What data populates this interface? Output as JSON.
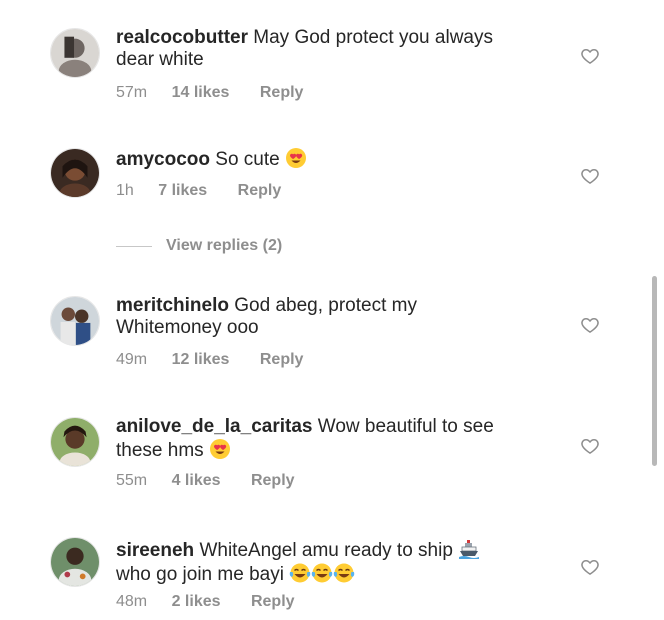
{
  "comments": [
    {
      "username": "realcocobutter",
      "text_line1": "May God protect you always",
      "text_line2": "dear white",
      "time": "57m",
      "likes": "14 likes",
      "reply": "Reply",
      "avatar_icon": "avatar-photo-icon",
      "emoji": []
    },
    {
      "username": "amycocoo",
      "text_line1": "So cute",
      "text_line2": "",
      "time": "1h",
      "likes": "7 likes",
      "reply": "Reply",
      "avatar_icon": "avatar-photo-icon",
      "emoji": [
        "heart-eyes-emoji"
      ]
    },
    {
      "username": "meritchinelo",
      "text_line1": "God abeg, protect my",
      "text_line2": "Whitemoney ooo",
      "time": "49m",
      "likes": "12 likes",
      "reply": "Reply",
      "avatar_icon": "avatar-photo-icon",
      "emoji": []
    },
    {
      "username": "anilove_de_la_caritas",
      "text_line1": "Wow beautiful to see",
      "text_line2": "these hms",
      "time": "55m",
      "likes": "4 likes",
      "reply": "Reply",
      "avatar_icon": "avatar-photo-icon",
      "emoji": [
        "heart-eyes-emoji"
      ]
    },
    {
      "username": "sireeneh",
      "text_line1": "WhiteAngel amu ready to ship",
      "text_line2": "who go join me bayi",
      "time": "48m",
      "likes": "2 likes",
      "reply": "Reply",
      "avatar_icon": "avatar-photo-icon",
      "emoji": [
        "ship-emoji",
        "tears-of-joy-emoji",
        "tears-of-joy-emoji",
        "tears-of-joy-emoji"
      ]
    }
  ],
  "view_replies": {
    "label": "View replies (2)"
  },
  "icons": {
    "like": "heart-outline-icon"
  },
  "colors": {
    "text_primary": "#262626",
    "text_secondary": "#8e8e8e",
    "divider": "#c7c7c7",
    "scrollbar": "#b8b8b8"
  }
}
